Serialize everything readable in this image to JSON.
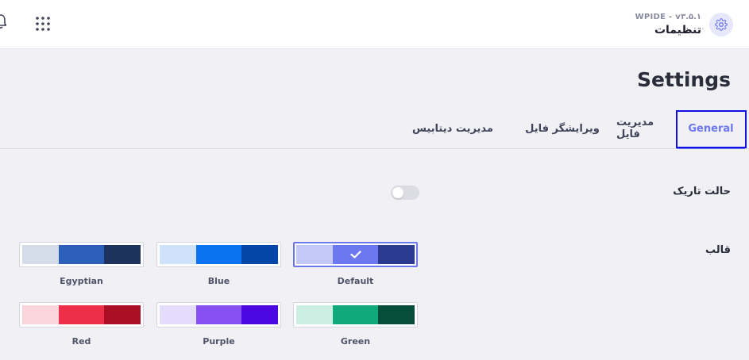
{
  "header": {
    "version": "WPIDE - v۳.۵.۱",
    "title": "تنظیمات"
  },
  "page": {
    "title": "Settings"
  },
  "tabs": [
    {
      "label": "General",
      "active": true
    },
    {
      "label": "مدیریت فایل",
      "active": false
    },
    {
      "label": "ویرایشگر فایل",
      "active": false
    },
    {
      "label": "مدیریت دیتابیس",
      "active": false
    }
  ],
  "settings": {
    "dark_mode": {
      "label": "حالت تاریک",
      "enabled": false
    },
    "theme": {
      "label": "قالب",
      "selected": "Default",
      "options": [
        {
          "name": "Default",
          "colors": [
            "#c3c8f7",
            "#6c78f0",
            "#2b3a8f"
          ]
        },
        {
          "name": "Blue",
          "colors": [
            "#cfe2fb",
            "#0a74f0",
            "#0445a8"
          ]
        },
        {
          "name": "Egyptian",
          "colors": [
            "#d4dcea",
            "#2c60b8",
            "#1d335e"
          ]
        },
        {
          "name": "Green",
          "colors": [
            "#cdeee2",
            "#0fa97c",
            "#064d3a"
          ]
        },
        {
          "name": "Purple",
          "colors": [
            "#e3dcfb",
            "#8750f3",
            "#4c08e0"
          ]
        },
        {
          "name": "Red",
          "colors": [
            "#fbd5dc",
            "#ee2f4a",
            "#aa0f25"
          ]
        }
      ]
    }
  },
  "colors": {
    "accent": "#6c78f0",
    "focus_outline": "#1010e0"
  },
  "icons": {
    "bell": "bell-icon",
    "apps": "grid-icon",
    "settings": "gear-icon",
    "check": "check-icon"
  }
}
